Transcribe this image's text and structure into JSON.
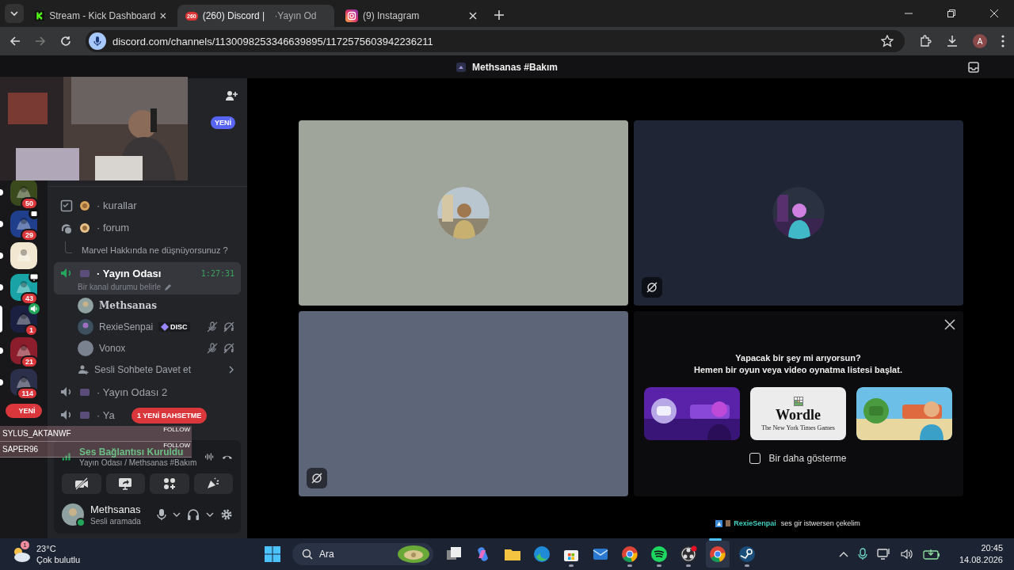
{
  "browser": {
    "tabs": [
      {
        "kind": "kick",
        "title": "Stream - Kick Dashboard",
        "selected": false
      },
      {
        "kind": "discord",
        "badge": "260",
        "title": "(260) Discord |",
        "title_after": "·Yayın Od",
        "recording": true,
        "selected": true
      },
      {
        "kind": "instagram",
        "title": "(9) Instagram",
        "selected": false
      }
    ],
    "url": "discord.com/channels/1130098253346639895/1172575603942236211",
    "profile": "A"
  },
  "webcam": {
    "kind": "picture"
  },
  "discord": {
    "title": "Methsanas #Bakım",
    "header": {
      "badge": "YENİ"
    },
    "servers": [
      {
        "kind": "plain",
        "color": "#3b4a1c",
        "badge": "50",
        "unread": true,
        "selected": false
      },
      {
        "kind": "event",
        "color": "#1f3f8c",
        "badge": "29",
        "unread": true,
        "selected": false
      },
      {
        "kind": "plain",
        "color": "#f2e8d2",
        "unread": true,
        "selected": false
      },
      {
        "kind": "screen",
        "color": "#1aa3a6",
        "badge": "43",
        "unread": true,
        "selected": false
      },
      {
        "kind": "voice",
        "color": "#1c2040",
        "badge": "1",
        "unread": false,
        "selected": true
      },
      {
        "kind": "plain",
        "color": "#8c1d2c",
        "badge": "21",
        "unread": true,
        "selected": false
      },
      {
        "kind": "plain",
        "color": "#2c2f4a",
        "badge": "114",
        "unread": true,
        "selected": false
      }
    ],
    "new_pill": "YENİ",
    "channels": [
      {
        "kind": "text",
        "name": "· kurallar"
      },
      {
        "kind": "forum",
        "name": "· forum"
      },
      {
        "kind": "thread",
        "name": "Marvel Hakkında ne düşnüyorsunuz ?"
      },
      {
        "kind": "voice",
        "name": "· Yayın Odası",
        "selected": true,
        "timer": "1:27:31",
        "status": "Bir kanal durumu belirle",
        "invite": "Sesli Sohbete Davet et",
        "members": [
          {
            "name": "Methsanas",
            "muted": false,
            "deafened": false
          },
          {
            "name": "RexieSenpai",
            "tag": "DISC",
            "muted": true,
            "deafened": true
          },
          {
            "name": "Vonox",
            "muted": true,
            "deafened": true
          }
        ]
      },
      {
        "kind": "voice",
        "name": "· Yayın Odası 2",
        "selected": false
      },
      {
        "kind": "voice",
        "name": "· Ya",
        "selected": false
      }
    ],
    "mention_pill": "1 YENİ BAHSETME",
    "alerts": [
      {
        "name": "SYLUS_AKTANWF",
        "action": "FOLLOW"
      },
      {
        "name": "SAPER96",
        "action": "FOLLOW"
      }
    ],
    "voice_panel": {
      "status": "Ses Bağlantısı Kuruldu",
      "channel": "Yayın Odası / Methsanas #Bakım"
    },
    "user": {
      "name": "Methsanas",
      "status": "Sesli aramada",
      "online": true
    },
    "tiles": [
      {
        "kind": "avatar",
        "color": "#a0a59b",
        "video_muted": false
      },
      {
        "kind": "avatar",
        "color": "#1f2535",
        "video_muted": true
      },
      {
        "kind": "empty",
        "color": "#5d6579",
        "video_muted": true
      }
    ],
    "activity_panel": {
      "heading": "Yapacak bir şey mi arıyorsun?",
      "subheading": "Hemen bir oyun veya video oynatma listesi başlat.",
      "games": [
        {
          "kind": "picture"
        },
        {
          "kind": "wordle",
          "title": "Wordle",
          "subtitle": "The New York Times Games"
        },
        {
          "kind": "picture"
        }
      ],
      "checkbox": {
        "label": "Bir daha gösterme",
        "checked": false
      }
    },
    "caption": {
      "name": "RexieSenpai",
      "text": "ses gir istwersen çekelim"
    }
  },
  "taskbar": {
    "weather": {
      "badge": "1",
      "temp": "23°C",
      "desc": "Çok bulutlu"
    },
    "search": {
      "placeholder": "Ara"
    },
    "apps": [
      {
        "kind": "taskview",
        "running": false,
        "active": false
      },
      {
        "kind": "copilot",
        "running": false,
        "active": false
      },
      {
        "kind": "explorer",
        "running": false,
        "active": false
      },
      {
        "kind": "edge",
        "running": false,
        "active": false
      },
      {
        "kind": "store",
        "running": true,
        "active": false
      },
      {
        "kind": "mail",
        "running": false,
        "active": false
      },
      {
        "kind": "chrome",
        "running": true,
        "active": false
      },
      {
        "kind": "spotify",
        "running": true,
        "active": false
      },
      {
        "kind": "obs",
        "running": true,
        "active": false
      },
      {
        "kind": "chrome",
        "running": true,
        "active": true
      },
      {
        "kind": "steam",
        "running": true,
        "active": false
      }
    ],
    "time": "20:45",
    "date": "14.08.2026"
  }
}
